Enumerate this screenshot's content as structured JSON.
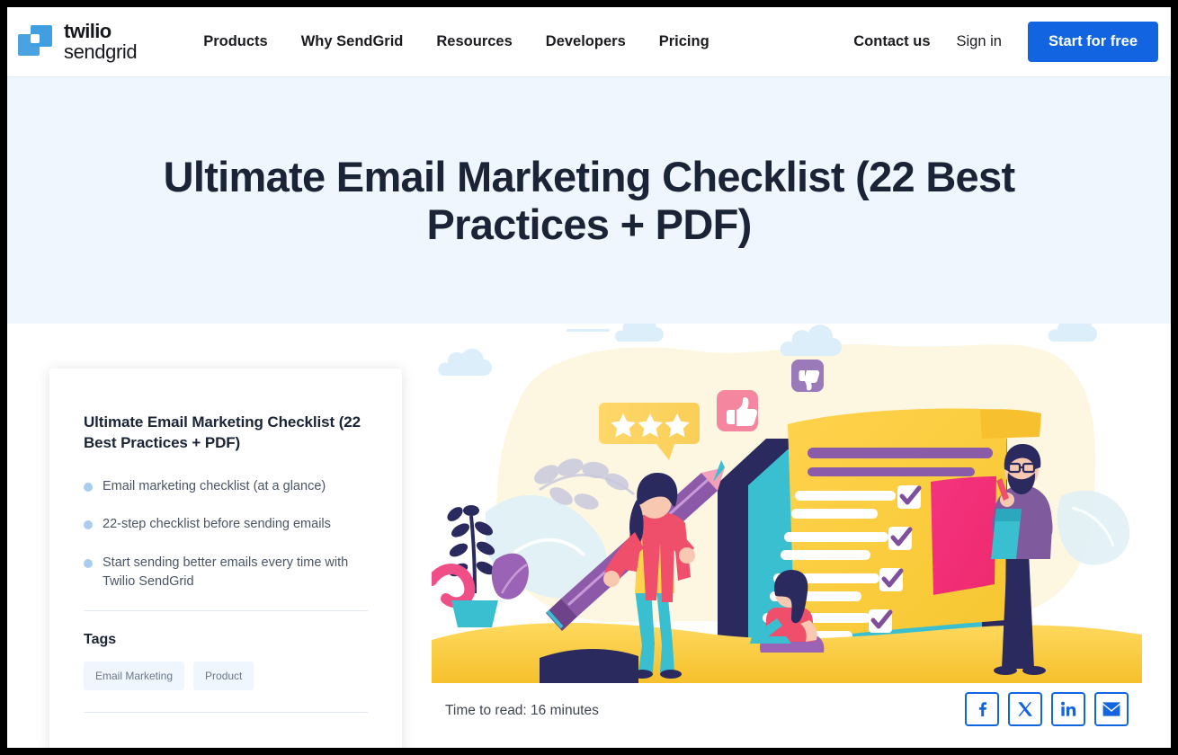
{
  "brand": {
    "line1": "twilio",
    "line2": "sendgrid",
    "logo_icon": "twilio-sendgrid-logo-icon",
    "logo_color": "#4aa3e0"
  },
  "nav": {
    "links": [
      {
        "label": "Products"
      },
      {
        "label": "Why SendGrid"
      },
      {
        "label": "Resources"
      },
      {
        "label": "Developers"
      },
      {
        "label": "Pricing"
      }
    ],
    "contact_label": "Contact us",
    "signin_label": "Sign in",
    "cta_label": "Start for free",
    "cta_color": "#1264e0"
  },
  "hero": {
    "title": "Ultimate Email Marketing Checklist (22 Best Practices + PDF)",
    "background_color": "#eff6fd",
    "title_color": "#1b2437"
  },
  "sidebar": {
    "title": "Ultimate Email Marketing Checklist (22 Best Practices + PDF)",
    "bullets": [
      "Email marketing checklist (at a glance)",
      "22-step checklist before sending emails",
      "Start sending better emails every time with Twilio SendGrid"
    ],
    "bullet_color": "#a8cdf0",
    "tags_heading": "Tags",
    "tags": [
      {
        "label": "Email Marketing"
      },
      {
        "label": "Product"
      }
    ],
    "tag_background": "#eff6fd"
  },
  "article": {
    "read_time": "Time to read: 16 minutes",
    "illustration_alt": "email-marketing-checklist-illustration"
  },
  "share": {
    "buttons": [
      {
        "name": "facebook",
        "label": "f"
      },
      {
        "name": "x-twitter",
        "label": "X"
      },
      {
        "name": "linkedin",
        "label": "in"
      },
      {
        "name": "email",
        "label": "email"
      }
    ],
    "accent_color": "#1264e0"
  }
}
